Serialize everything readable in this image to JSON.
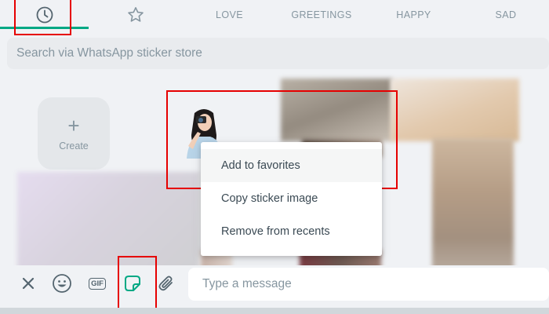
{
  "tabs": [
    {
      "icon": "clock-icon",
      "label": ""
    },
    {
      "icon": "star-icon",
      "label": ""
    },
    {
      "label": "LOVE"
    },
    {
      "label": "GREETINGS"
    },
    {
      "label": "HAPPY"
    },
    {
      "label": "SAD"
    }
  ],
  "search": {
    "placeholder": "Search via WhatsApp sticker store"
  },
  "create": {
    "label": "Create"
  },
  "context_menu": {
    "items": [
      {
        "label": "Add to favorites"
      },
      {
        "label": "Copy sticker image"
      },
      {
        "label": "Remove from recents"
      }
    ]
  },
  "composer": {
    "placeholder": "Type a message",
    "gif_label": "GIF"
  },
  "colors": {
    "accent": "#00a884",
    "highlight": "#e60000",
    "icon": "#54656f",
    "muted": "#8696a0"
  }
}
